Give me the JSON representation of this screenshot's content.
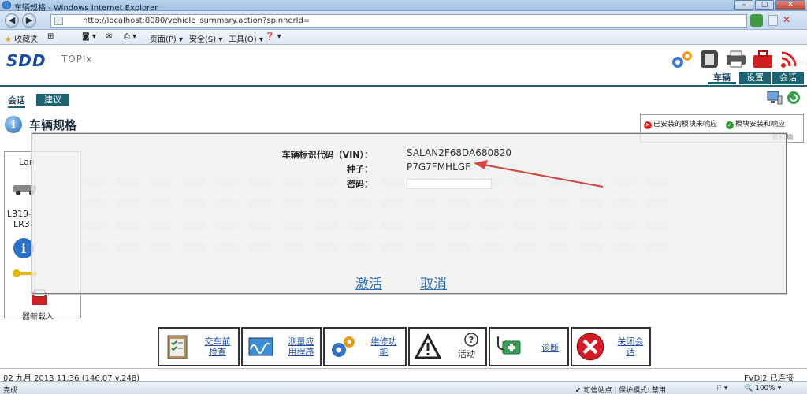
{
  "browser": {
    "title": "车辆规格 - Windows Internet Explorer",
    "url": "http://localhost:8080/vehicle_summary.action?spinnerId=",
    "favorites_label": "收藏夹",
    "menu_page": "页面(P) ▾",
    "menu_safety": "安全(S) ▾",
    "menu_tools": "工具(O) ▾",
    "menu_help": "❓ ▾",
    "status_left": "完成",
    "status_site": "✔ 可信站点 | 保护模式: 禁用",
    "zoom": "100%"
  },
  "app": {
    "logo": "SDD",
    "product": "TOPIx",
    "nav_tabs": [
      "车辆",
      "设置",
      "会话"
    ],
    "sub_tabs": [
      "会话",
      "建议"
    ],
    "page_title": "车辆规格"
  },
  "legend": {
    "item1": "已安装的模块未响应",
    "item2": "模块安装和响应",
    "item3": "装和响"
  },
  "left_panel": {
    "line1": "Lan",
    "line2": "L319-",
    "line3": "LR3",
    "line4": "器新载入"
  },
  "dialog": {
    "vin_label": "车辆标识代码（VIN）：",
    "vin_value": "SALAN2F68DA680820",
    "seed_label": "种子：",
    "seed_value": "P7G7FMHLGF",
    "password_label": "密码：",
    "activate": "激活",
    "cancel": "取消"
  },
  "toolbar": [
    {
      "label_l1": "交车前",
      "label_l2": "检查"
    },
    {
      "label_l1": "测量应",
      "label_l2": "用程序"
    },
    {
      "label_l1": "维修功",
      "label_l2": "能"
    },
    {
      "label_l1": "活动"
    },
    {
      "label_l1": "诊断"
    },
    {
      "label_l1": "关闭会",
      "label_l2": "话"
    }
  ],
  "status": {
    "datetime": "02 九月 2013 11:36 (146.07 v.248)",
    "fvdi": "FVDI2 已连接"
  },
  "colors": {
    "accent": "#1e6470",
    "link": "#2a6fb8",
    "arrow": "#d94040"
  }
}
